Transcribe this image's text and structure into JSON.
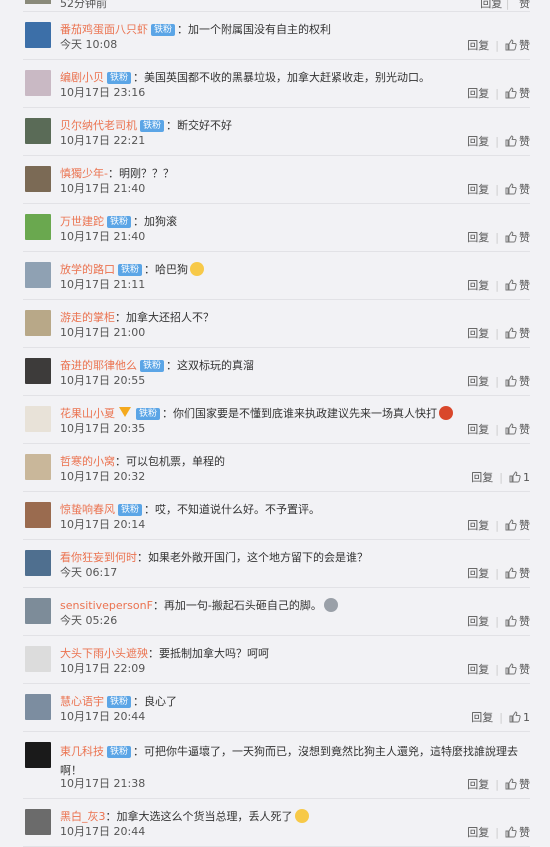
{
  "top_partial": {
    "time": "52分钟前",
    "reply": "回复",
    "like": "赞"
  },
  "reply_label": "回复",
  "like_label": "赞",
  "badge_label": "铁粉",
  "comments": [
    {
      "user": "番茄鸡蛋面八只虾",
      "badge": true,
      "text": "：加一个附属国没有自主的权利",
      "time": "今天 10:08",
      "likes": "赞",
      "avatar": "#3c6fa8"
    },
    {
      "user": "编剧小贝",
      "badge": true,
      "text": "：美国英国都不收的黑暴垃圾，加拿大赶紧收走，别光动口。",
      "time": "10月17日 23:16",
      "likes": "赞",
      "avatar": "#c9b9c4"
    },
    {
      "user": "贝尔纳代老司机",
      "badge": true,
      "text": "：断交好不好",
      "time": "10月17日 22:21",
      "likes": "赞",
      "avatar": "#5a6b57"
    },
    {
      "user": "慎獨少年-",
      "badge": false,
      "text": "：明刚？？？",
      "time": "10月17日 21:40",
      "likes": "赞",
      "avatar": "#7b6a55"
    },
    {
      "user": "万世建跎",
      "badge": true,
      "text": "：加狗滚",
      "time": "10月17日 21:40",
      "likes": "赞",
      "avatar": "#6aa84f"
    },
    {
      "user": "放学的路口",
      "badge": true,
      "text": "：哈巴狗",
      "time": "10月17日 21:11",
      "likes": "赞",
      "avatar": "#8fa1b3",
      "emoji": "yellow"
    },
    {
      "user": "游走的掌柜",
      "badge": false,
      "text": "：加拿大还招人不？",
      "time": "10月17日 21:00",
      "likes": "赞",
      "avatar": "#b8a888"
    },
    {
      "user": "奋进的耶律他么",
      "badge": true,
      "text": "：这双标玩的真溜",
      "time": "10月17日 20:55",
      "likes": "赞",
      "avatar": "#3d3b3a"
    },
    {
      "user": "花果山小夏",
      "badge": true,
      "vip": true,
      "text": "：你们国家要是不懂到底谁来执政建议先来一场真人快打",
      "time": "10月17日 20:35",
      "likes": "赞",
      "avatar": "#e8e2d8",
      "emoji": "red"
    },
    {
      "user": "哲寒的小窝",
      "badge": false,
      "text": "：可以包机票，单程的",
      "time": "10月17日 20:32",
      "likes": "1",
      "avatar": "#c9b79a"
    },
    {
      "user": "惊蛰响春风",
      "badge": true,
      "text": "：哎，不知道说什么好。不予置评。",
      "time": "10月17日 20:14",
      "likes": "赞",
      "avatar": "#9a6b4f"
    },
    {
      "user": "看你狂妄到何时",
      "badge": false,
      "text": "：如果老外敞开国门，这个地方留下的会是谁？",
      "time": "今天 06:17",
      "likes": "赞",
      "avatar": "#4f6f8f"
    },
    {
      "user": "sensitivepersonF",
      "badge": false,
      "text": "：再加一句-搬起石头砸自己的脚。",
      "time": "今天 05:26",
      "likes": "赞",
      "avatar": "#7d8c99",
      "emoji": "gray"
    },
    {
      "user": "大头下雨小头遮殃",
      "badge": false,
      "text": "：要抵制加拿大吗？呵呵",
      "time": "10月17日 22:09",
      "likes": "赞",
      "avatar": "#dcdcdc"
    },
    {
      "user": "慧心语宇",
      "badge": true,
      "text": "：良心了",
      "time": "10月17日 20:44",
      "likes": "1",
      "avatar": "#7c8da0"
    },
    {
      "user": "東几科技",
      "badge": true,
      "text": "：可把你牛逼壞了，一天狗而已，沒想到竟然比狗主人還兇，這特麼找誰說理去啊！",
      "time": "10月17日 21:38",
      "likes": "赞",
      "avatar": "#1a1a1a",
      "tall": true
    },
    {
      "user": "黑白_灰3",
      "badge": false,
      "text": "：加拿大选这么个货当总理，丢人死了",
      "time": "10月17日 20:44",
      "likes": "赞",
      "avatar": "#6b6b6b",
      "emoji": "yellow"
    }
  ]
}
